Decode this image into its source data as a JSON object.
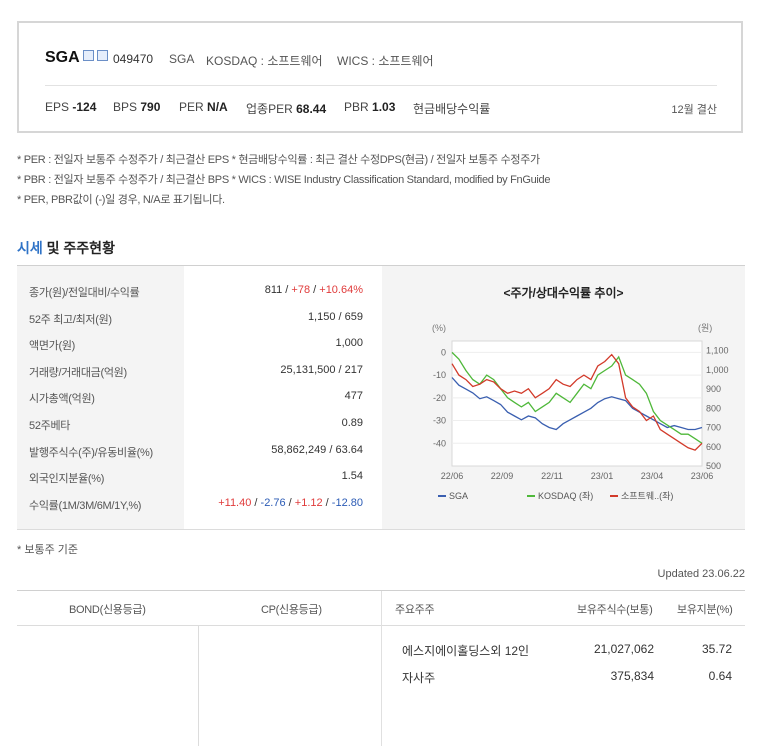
{
  "summary": {
    "name": "SGA",
    "code": "049470",
    "name_en": "SGA",
    "market": "KOSDAQ : 소프트웨어",
    "wics": "WICS : 소프트웨어",
    "eps_label": "EPS",
    "eps_value": "-124",
    "bps_label": "BPS",
    "bps_value": "790",
    "per_label": "PER",
    "per_value": "N/A",
    "ind_per_label": "업종PER",
    "ind_per_value": "68.44",
    "pbr_label": "PBR",
    "pbr_value": "1.03",
    "dividend_label": "현금배당수익률",
    "fiscal": "12월 결산"
  },
  "notes": [
    "* PER : 전일자 보통주 수정주가 / 최근결산 EPS * 현금배당수익률 : 최근 결산 수정DPS(현금) / 전일자 보통주 수정주가",
    "* PBR : 전일자 보통주 수정주가 / 최근결산 BPS * WICS : WISE Industry Classification Standard, modified by FnGuide",
    "* PER, PBR값이 (-)일 경우, N/A로 표기됩니다."
  ],
  "section": {
    "title_hl": "시세",
    "title_rest": " 및 주주현황"
  },
  "market": {
    "rows": [
      {
        "label": "종가(원)/전일대비/수익률",
        "v1": "811",
        "sep1": " / ",
        "v2": "+78",
        "sep2": " / ",
        "v3": "+10.64%"
      },
      {
        "label": "52주 최고/최저(원)",
        "value": "1,150 / 659"
      },
      {
        "label": "액면가(원)",
        "value": "1,000"
      },
      {
        "label": "거래량/거래대금(억원)",
        "value": "25,131,500 / 217"
      },
      {
        "label": "시가총액(억원)",
        "value": "477"
      },
      {
        "label": "52주베타",
        "value": "0.89"
      },
      {
        "label": "발행주식수(주)/유동비율(%)",
        "value": "58,862,249 / 63.64"
      },
      {
        "label": "외국인지분율(%)",
        "value": "1.54"
      },
      {
        "label": "수익률(1M/3M/6M/1Y,%)",
        "r1": "+11.40",
        "r2": "-2.76",
        "r3": "+1.12",
        "r4": "-12.80",
        "sep": " / "
      }
    ]
  },
  "chart_data": {
    "type": "line",
    "title": "<주가/상대수익률 추이>",
    "left_unit": "(%)",
    "right_unit": "(원)",
    "x_ticks": [
      "22/06",
      "22/09",
      "22/11",
      "23/01",
      "23/04",
      "23/06"
    ],
    "y_left_ticks": [
      0,
      -10,
      -20,
      -30,
      -40
    ],
    "y_left_range": [
      -50,
      5
    ],
    "y_right_ticks": [
      "1,100",
      "1,000",
      "900",
      "800",
      "700",
      "600",
      "500"
    ],
    "y_right_range": [
      500,
      1150
    ],
    "legend": [
      "SGA",
      "KOSDAQ (좌)",
      "소프트웨..(좌)"
    ],
    "colors": {
      "sga": "#3a5fb0",
      "kosdaq": "#4fb83a",
      "sw": "#d23a2a"
    },
    "series": [
      {
        "name": "SGA",
        "axis": "right",
        "color": "#3a5fb0",
        "values": [
          960,
          920,
          900,
          880,
          850,
          860,
          840,
          820,
          780,
          760,
          740,
          760,
          750,
          720,
          700,
          690,
          720,
          740,
          760,
          780,
          800,
          830,
          850,
          860,
          850,
          840,
          800,
          780,
          760,
          740,
          720,
          700,
          710,
          700,
          690,
          690,
          700
        ]
      },
      {
        "name": "KOSDAQ (좌)",
        "axis": "left",
        "color": "#4fb83a",
        "values": [
          0,
          -3,
          -8,
          -12,
          -14,
          -10,
          -12,
          -16,
          -20,
          -22,
          -24,
          -22,
          -26,
          -24,
          -22,
          -18,
          -20,
          -22,
          -18,
          -14,
          -16,
          -10,
          -8,
          -6,
          -2,
          -10,
          -12,
          -14,
          -18,
          -26,
          -30,
          -32,
          -34,
          -36,
          -36,
          -38,
          -40
        ]
      },
      {
        "name": "소프트웨..(좌)",
        "axis": "left",
        "color": "#d23a2a",
        "values": [
          -5,
          -10,
          -12,
          -15,
          -14,
          -12,
          -13,
          -16,
          -18,
          -17,
          -18,
          -16,
          -20,
          -18,
          -16,
          -12,
          -14,
          -15,
          -12,
          -10,
          -12,
          -6,
          -4,
          -1,
          -5,
          -20,
          -24,
          -26,
          -30,
          -28,
          -34,
          -36,
          -38,
          -40,
          -42,
          -43,
          -40
        ]
      }
    ]
  },
  "footnote": "* 보통주 기준",
  "updated": "Updated 23.06.22",
  "holders": {
    "col_bond": "BOND(신용등급)",
    "col_cp": "CP(신용등급)",
    "col_major": "주요주주",
    "col_shares": "보유주식수(보통)",
    "col_pct": "보유지분(%)",
    "rows": [
      {
        "name": "에스지에이홀딩스외 12인",
        "shares": "21,027,062",
        "pct": "35.72"
      },
      {
        "name": "자사주",
        "shares": "375,834",
        "pct": "0.64"
      }
    ]
  }
}
